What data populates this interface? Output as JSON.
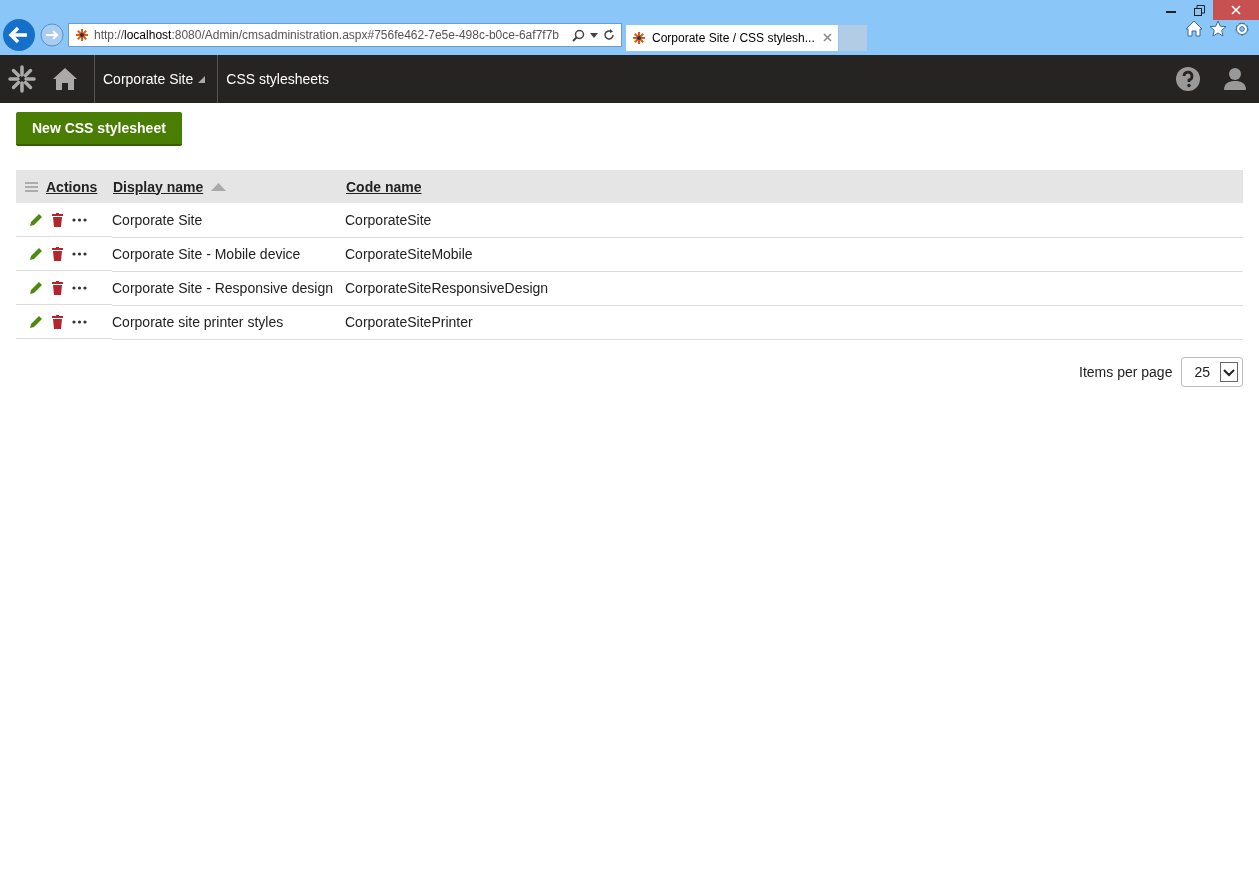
{
  "browser": {
    "url": "http://**localhost**:8080/Admin/cmsadministration.aspx#756fe462-7e5e-498c-b0ce-6af7f7b",
    "tab_title": "Corporate Site / CSS stylesh..."
  },
  "header": {
    "site": "Corporate Site",
    "page": "CSS stylesheets"
  },
  "new_button": "New CSS stylesheet",
  "table": {
    "columns": [
      {
        "label": "Actions",
        "sorted": false
      },
      {
        "label": "Display name",
        "sorted": true
      },
      {
        "label": "Code name",
        "sorted": false
      }
    ],
    "rows": [
      {
        "display_name": "Corporate Site",
        "code_name": "CorporateSite"
      },
      {
        "display_name": "Corporate Site - Mobile device",
        "code_name": "CorporateSiteMobile"
      },
      {
        "display_name": "Corporate Site - Responsive design",
        "code_name": "CorporateSiteResponsiveDesign"
      },
      {
        "display_name": "Corporate site printer styles",
        "code_name": "CorporateSitePrinter"
      }
    ]
  },
  "pager": {
    "label": "Items per page",
    "value": "25"
  }
}
